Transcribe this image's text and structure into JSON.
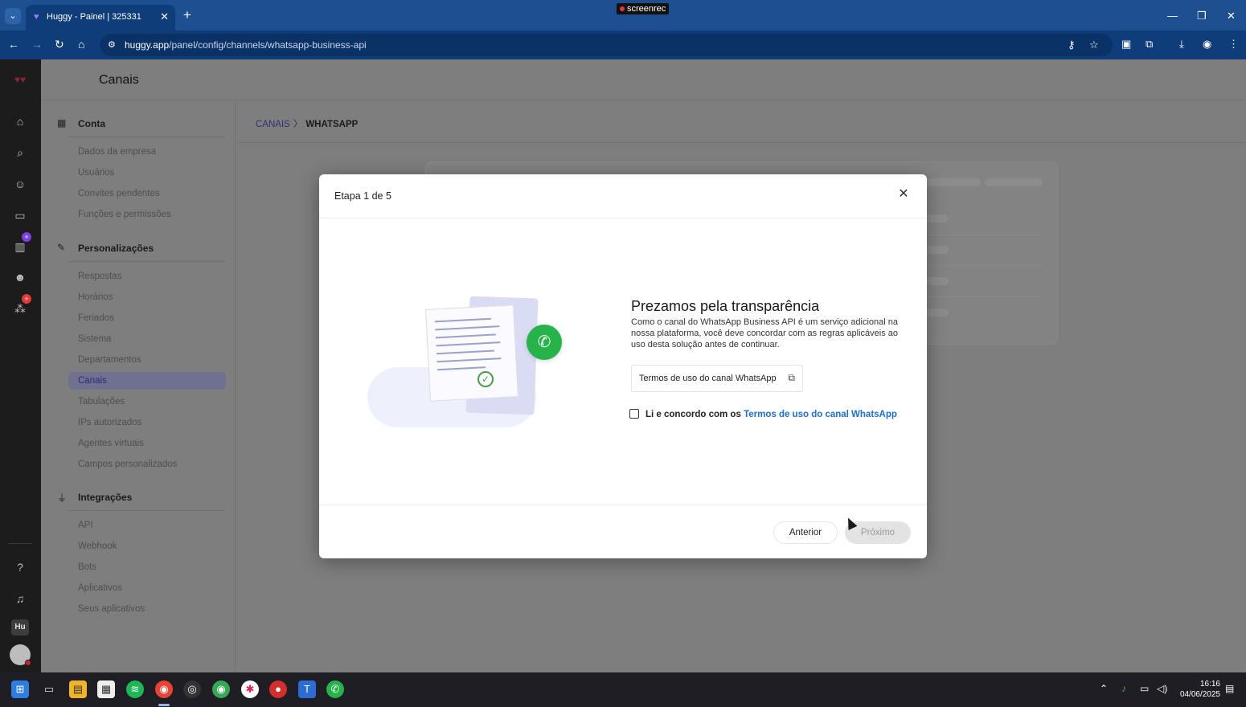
{
  "browser": {
    "tab_title": "Huggy - Painel | 325331",
    "url_host": "huggy.app",
    "url_path": "/panel/config/channels/whatsapp-business-api",
    "recorder_label": "screenrec",
    "icons": [
      "tab-list-icon",
      "close-icon",
      "plus-icon",
      "minimize-icon",
      "restore-icon",
      "close-window-icon",
      "back-icon",
      "forward-icon",
      "reload-icon",
      "home-icon",
      "site-info-icon",
      "password-key-icon",
      "star-icon",
      "extension-icon",
      "puzzle-icon",
      "download-icon",
      "profile-icon",
      "kebab-menu-icon"
    ]
  },
  "rail": {
    "icons": [
      "huggy-logo",
      "home-icon",
      "search-icon",
      "contact-icon",
      "chat-icon",
      "reports-icon",
      "bot-icon",
      "apps-icon",
      "help-icon",
      "bell-icon"
    ],
    "avatar_initials": "Hu",
    "badge_color": "#7b3fe4",
    "alert_color": "#e53935"
  },
  "header": {
    "title": "Canais"
  },
  "settings_nav": {
    "sections": [
      {
        "label": "Conta",
        "icon": "building-icon",
        "items": [
          "Dados da empresa",
          "Usuários",
          "Convites pendentes",
          "Funções e permissões"
        ]
      },
      {
        "label": "Personalizações",
        "icon": "pencil-icon",
        "items": [
          "Respostas",
          "Horários",
          "Feriados",
          "Sistema",
          "Departamentos",
          "Canais",
          "Tabulações",
          "IPs autorizados",
          "Agentes virtuais",
          "Campos personalizados"
        ]
      },
      {
        "label": "Integrações",
        "icon": "plug-icon",
        "items": [
          "API",
          "Webhook",
          "Bots",
          "Aplicativos",
          "Seus aplicativos"
        ]
      }
    ],
    "active_item": "Canais"
  },
  "breadcrumb": {
    "parent": "CANAIS",
    "separator": "〉",
    "current": "WHATSAPP"
  },
  "modal": {
    "step": "Etapa 1 de 5",
    "title": "Prezamos pela transparência",
    "description": "Como o canal do WhatsApp Business API é um serviço adicional na nossa plataforma, você deve concordar com as regras aplicáveis ao uso desta solução antes de continuar.",
    "terms_button": "Termos de uso do canal WhatsApp",
    "agree_prefix": "Li e concordo com os",
    "agree_link": "Termos de uso do canal WhatsApp",
    "agree_checked": false,
    "prev_button": "Anterior",
    "next_button": "Próximo",
    "next_enabled": false,
    "accent_color": "#1a6fd1",
    "whatsapp_color": "#25b34a"
  },
  "taskbar": {
    "apps": [
      "windows-start-icon",
      "task-view-icon",
      "file-explorer-icon",
      "store-icon",
      "spotify-icon",
      "chrome-icon",
      "obs-icon",
      "chrome-profile-icon",
      "slack-icon",
      "screenrec-icon",
      "teams-icon",
      "whatsapp-icon"
    ],
    "time": "16:16",
    "date": "04/06/2025"
  }
}
